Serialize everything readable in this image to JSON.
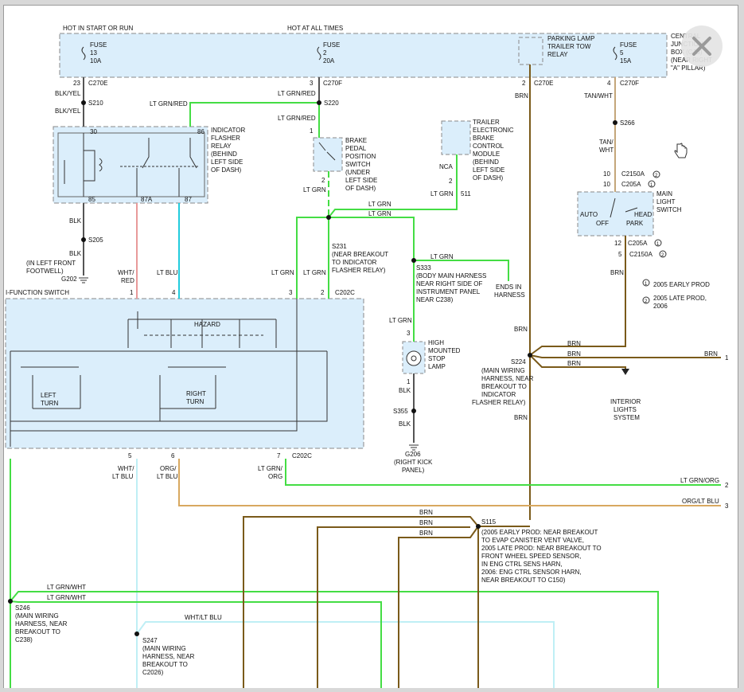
{
  "top": {
    "hot_start_run": "HOT IN START OR RUN",
    "hot_all_times": "HOT AT ALL TIMES"
  },
  "cjb": [
    "CENTRAL",
    "JUNCTION",
    "BOX (CJB)",
    "(NEAR RIGHT",
    "\"A\" PILLAR)"
  ],
  "fuse13": [
    "FUSE",
    "13",
    "10A"
  ],
  "fuse2": [
    "FUSE",
    "2",
    "20A"
  ],
  "fuse5": [
    "FUSE",
    "5",
    "15A"
  ],
  "tow_relay": [
    "PARKING LAMP",
    "TRAILER TOW",
    "RELAY"
  ],
  "conn": {
    "c270e_23": "23",
    "c270e": "C270E",
    "c270f_3": "3",
    "c270f": "C270F",
    "c270e_2": "2",
    "c270f_4": "4",
    "c2150a": "C2150A",
    "c205a": "C205A",
    "c2150a_10": "10",
    "c205a_10": "10",
    "c205a_12": "12",
    "c2150a_5": "5",
    "c202c": "C202C"
  },
  "wires": {
    "blk_yel": "BLK/YEL",
    "lt_grn_red": "LT GRN/RED",
    "lt_grn": "LT GRN",
    "brn": "BRN",
    "tan_wht": "TAN/WHT",
    "tan": "TAN/",
    "wht": "WHT",
    "blk": "BLK",
    "wht_red": [
      "WHT/",
      "RED"
    ],
    "lt_blu": "LT BLU",
    "nca": "NCA",
    "wht_lt_blu": [
      "WHT/",
      "LT BLU"
    ],
    "org_lt_blu": [
      "ORG/",
      "LT BLU"
    ],
    "lt_grn_org": [
      "LT GRN/",
      "ORG"
    ],
    "lt_grn_org_1": "LT GRN/ORG",
    "org_lt_blu_1": "ORG/LT BLU",
    "lt_grn_wht": "LT GRN/WHT",
    "wht_lt_blu_1": "WHT/LT BLU",
    "c511": "511"
  },
  "splices": {
    "s210": "S210",
    "s220": "S220",
    "s205": "S205",
    "s266": "S266",
    "s231": "S231",
    "s231_desc": [
      "(NEAR BREAKOUT",
      "TO INDICATOR",
      "FLASHER RELAY)"
    ],
    "s333": "S333",
    "s333_desc": [
      "(BODY MAIN HARNESS",
      "NEAR RIGHT SIDE OF",
      "INSTRUMENT PANEL",
      "NEAR C238)"
    ],
    "ends": [
      "ENDS IN",
      "HARNESS"
    ],
    "s224": "S224",
    "s224_desc": [
      "(MAIN WIRING",
      "HARNESS, NEAR",
      "BREAKOUT TO",
      "INDICATOR",
      "FLASHER RELAY)"
    ],
    "s355": "S355",
    "g206": "G206",
    "g206_desc": [
      "(RIGHT KICK",
      "PANEL)"
    ],
    "g202": "G202",
    "g202_desc": [
      "(IN LEFT FRONT",
      "FOOTWELL)"
    ],
    "s115": "S115",
    "s115_desc": [
      "(2005 EARLY PROD: NEAR BREAKOUT",
      "TO EVAP CANISTER VENT VALVE,",
      "2005 LATE PROD: NEAR BREAKOUT TO",
      "FRONT WHEEL SPEED SENSOR,",
      "IN ENG CTRL SENS HARN,",
      "2006: ENG CTRL SENSOR HARN,",
      "NEAR BREAKOUT TO C150)"
    ],
    "s246": "S246",
    "s246_desc": [
      "(MAIN WIRING",
      "HARNESS, NEAR",
      "BREAKOUT TO",
      "C238)"
    ],
    "s247": "S247",
    "s247_desc": [
      "(MAIN WIRING",
      "HARNESS, NEAR",
      "BREAKOUT TO",
      "C2026)"
    ]
  },
  "flasher": {
    "desc": [
      "INDICATOR",
      "FLASHER",
      "RELAY",
      "(BEHIND",
      "LEFT SIDE",
      "OF DASH)"
    ],
    "p30": "30",
    "p86": "86",
    "p85": "85",
    "p87a": "87A",
    "p87": "87"
  },
  "brake_switch": [
    "BRAKE",
    "PEDAL",
    "POSITION",
    "SWITCH",
    "(UNDER",
    "LEFT SIDE",
    "OF DASH)"
  ],
  "trailer_module": [
    "TRAILER",
    "ELECTRONIC",
    "BRAKE",
    "CONTROL",
    "MODULE",
    "(BEHIND",
    "LEFT SIDE",
    "OF DASH)"
  ],
  "main_light": {
    "desc": [
      "MAIN",
      "LIGHT",
      "SWITCH"
    ],
    "auto": "AUTO",
    "off": "OFF",
    "head": "HEAD",
    "park": "PARK"
  },
  "legend": {
    "n1": "1",
    "n2": "2",
    "l1": "2005 EARLY PROD",
    "l2": [
      "2005 LATE PROD,",
      "2006"
    ]
  },
  "mfs": {
    "title": "I-FUNCTION SWITCH",
    "hazard": "HAZARD",
    "left": [
      "LEFT",
      "TURN"
    ],
    "right": [
      "RIGHT",
      "TURN"
    ],
    "p1": "1",
    "p4": "4",
    "p3": "3",
    "p2": "2",
    "p5": "5",
    "p6": "6",
    "p7": "7"
  },
  "stop_lamp": [
    "HIGH",
    "MOUNTED",
    "STOP",
    "LAMP"
  ],
  "interior": [
    "INTERIOR",
    "LIGHTS",
    "SYSTEM"
  ],
  "pins": {
    "n1": "1",
    "n2": "2",
    "n3": "3",
    "n4": "4",
    "n5": "5",
    "n6": "6",
    "n7": "7",
    "n10": "10",
    "n12": "12",
    "n2b": "2"
  },
  "offpage": {
    "r1": "1",
    "r2": "2",
    "r3": "3"
  },
  "colors": {
    "brn": "#7a5a1a",
    "ltgrn": "#44dd44",
    "ltblu": "#22ccdd",
    "wht_red": "#e89a9a",
    "org": "#d8a860",
    "light_blue_box": "#dbeefb"
  },
  "close_icon": "close-icon",
  "cursor_icon": "hand-cursor-icon"
}
